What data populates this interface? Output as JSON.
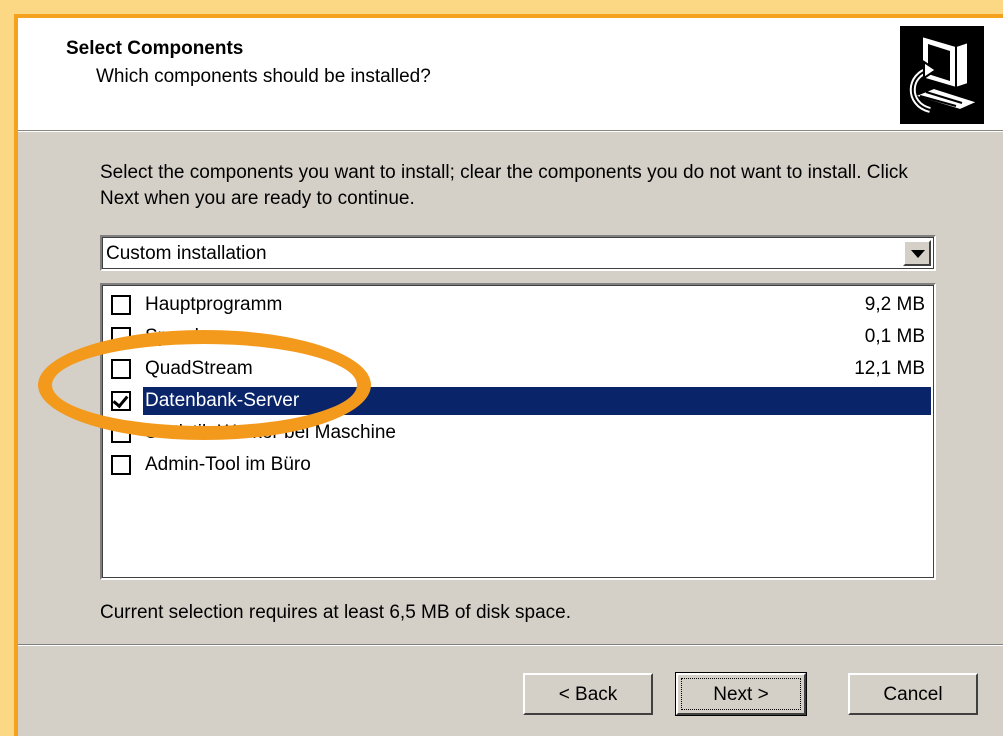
{
  "header": {
    "title": "Select Components",
    "subtitle": "Which components should be installed?",
    "logo_icon": "computer-install-icon"
  },
  "instructions": "Select the components you want to install; clear the components you do not want to install. Click Next when you are ready to continue.",
  "install_type": {
    "value": "Custom installation"
  },
  "components": [
    {
      "label": "Hauptprogramm",
      "size": "9,2 MB",
      "checked": false,
      "selected": false
    },
    {
      "label": "Sprachen",
      "size": "0,1 MB",
      "checked": false,
      "selected": false
    },
    {
      "label": "QuadStream",
      "size": "12,1 MB",
      "checked": false,
      "selected": false
    },
    {
      "label": "Datenbank-Server",
      "size": "",
      "checked": true,
      "selected": true
    },
    {
      "label": "Statistik-Worker bei Maschine",
      "size": "",
      "checked": false,
      "selected": false
    },
    {
      "label": "Admin-Tool im Büro",
      "size": "",
      "checked": false,
      "selected": false
    }
  ],
  "disk_space_text": "Current selection requires at least 6,5 MB of disk space.",
  "buttons": {
    "back": "< Back",
    "next": "Next >",
    "cancel": "Cancel"
  },
  "colors": {
    "selection": "#0a246a",
    "highlight_ring": "#f39a1c",
    "frame": "#f4a21d"
  }
}
